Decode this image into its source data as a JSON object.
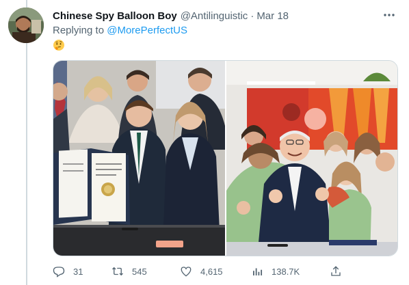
{
  "tweet": {
    "display_name": "Chinese Spy Balloon Boy",
    "handle": "@Antilinguistic",
    "separator": "·",
    "date": "Mar 18",
    "reply_prefix": "Replying to",
    "reply_to": "@MorePerfectUS",
    "emoji_icon": "thinking-face-icon"
  },
  "media": {
    "left_photo": "photo",
    "right_photo": "photo"
  },
  "stats": {
    "replies": "31",
    "retweets": "545",
    "likes": "4,615",
    "views": "138.7K"
  },
  "colors": {
    "link": "#1d9bf0",
    "muted": "#536471",
    "border": "#cfd9de"
  }
}
